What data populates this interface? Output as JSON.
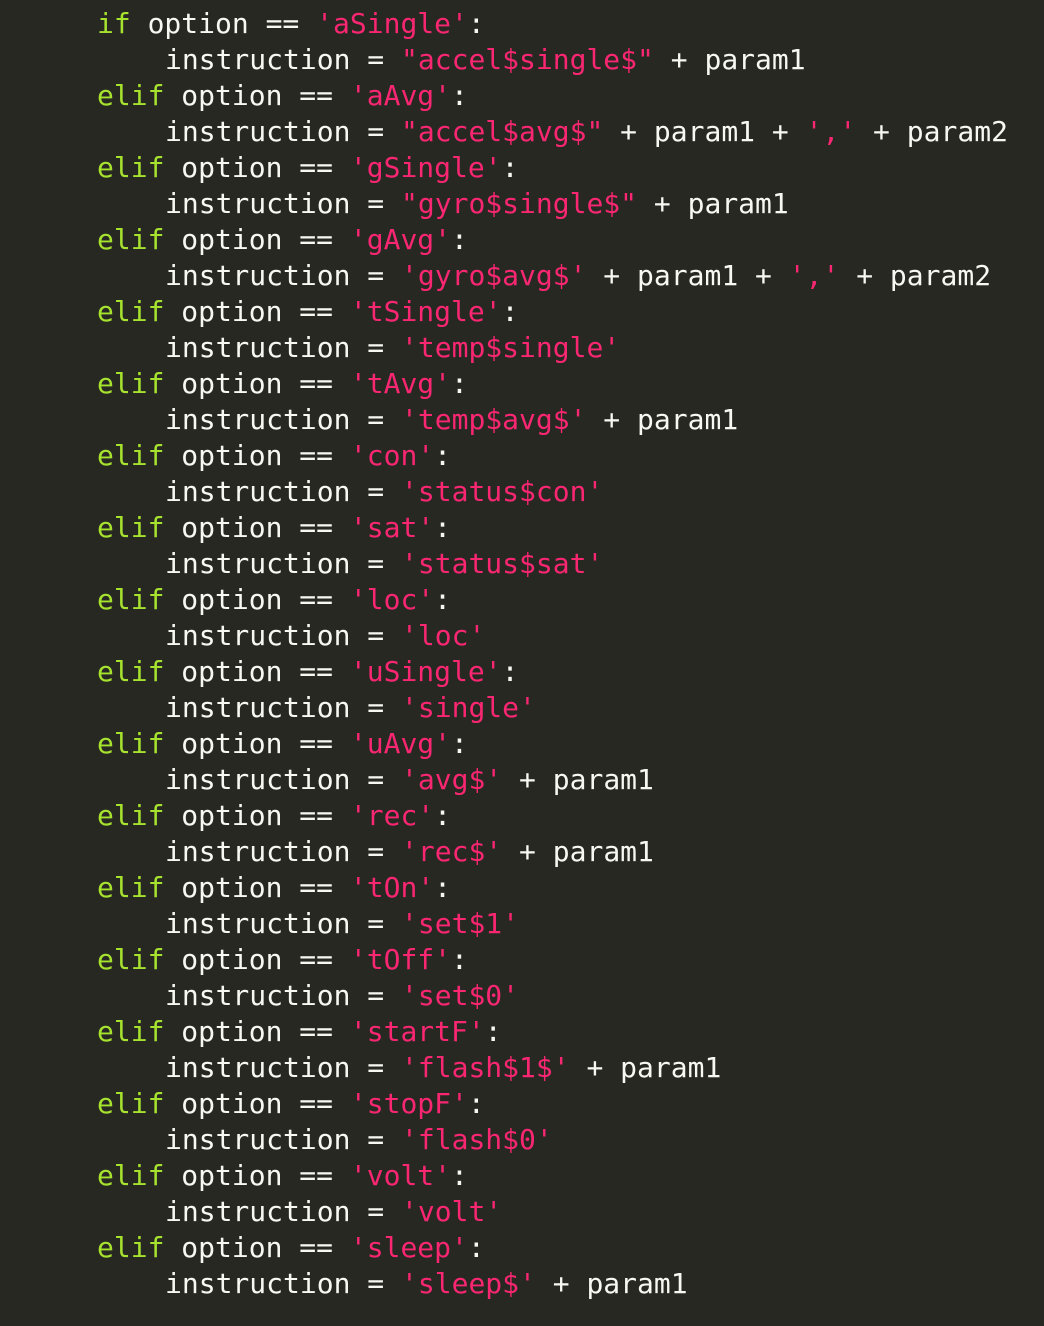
{
  "editor": {
    "theme_colors": {
      "background": "#272822",
      "keyword": "#a6e22e",
      "string": "#f92672",
      "text": "#f8f8f2"
    },
    "lines": [
      {
        "indent": 1,
        "tokens": [
          {
            "t": "kw",
            "v": "if"
          },
          {
            "t": "id",
            "v": " option "
          },
          {
            "t": "op",
            "v": "=="
          },
          {
            "t": "id",
            "v": " "
          },
          {
            "t": "str",
            "v": "'aSingle'"
          },
          {
            "t": "pun",
            "v": ":"
          }
        ]
      },
      {
        "indent": 2,
        "tokens": [
          {
            "t": "id",
            "v": "instruction "
          },
          {
            "t": "op",
            "v": "="
          },
          {
            "t": "id",
            "v": " "
          },
          {
            "t": "str",
            "v": "\"accel$single$\""
          },
          {
            "t": "op",
            "v": " + "
          },
          {
            "t": "id",
            "v": "param1"
          }
        ]
      },
      {
        "indent": 1,
        "tokens": [
          {
            "t": "kw",
            "v": "elif"
          },
          {
            "t": "id",
            "v": " option "
          },
          {
            "t": "op",
            "v": "=="
          },
          {
            "t": "id",
            "v": " "
          },
          {
            "t": "str",
            "v": "'aAvg'"
          },
          {
            "t": "pun",
            "v": ":"
          }
        ]
      },
      {
        "indent": 2,
        "tokens": [
          {
            "t": "id",
            "v": "instruction "
          },
          {
            "t": "op",
            "v": "="
          },
          {
            "t": "id",
            "v": " "
          },
          {
            "t": "str",
            "v": "\"accel$avg$\""
          },
          {
            "t": "op",
            "v": " + "
          },
          {
            "t": "id",
            "v": "param1"
          },
          {
            "t": "op",
            "v": " + "
          },
          {
            "t": "str",
            "v": "','"
          },
          {
            "t": "op",
            "v": " + "
          },
          {
            "t": "id",
            "v": "param2"
          }
        ]
      },
      {
        "indent": 1,
        "tokens": [
          {
            "t": "kw",
            "v": "elif"
          },
          {
            "t": "id",
            "v": " option "
          },
          {
            "t": "op",
            "v": "=="
          },
          {
            "t": "id",
            "v": " "
          },
          {
            "t": "str",
            "v": "'gSingle'"
          },
          {
            "t": "pun",
            "v": ":"
          }
        ]
      },
      {
        "indent": 2,
        "tokens": [
          {
            "t": "id",
            "v": "instruction "
          },
          {
            "t": "op",
            "v": "="
          },
          {
            "t": "id",
            "v": " "
          },
          {
            "t": "str",
            "v": "\"gyro$single$\""
          },
          {
            "t": "op",
            "v": " + "
          },
          {
            "t": "id",
            "v": "param1"
          }
        ]
      },
      {
        "indent": 1,
        "tokens": [
          {
            "t": "kw",
            "v": "elif"
          },
          {
            "t": "id",
            "v": " option "
          },
          {
            "t": "op",
            "v": "=="
          },
          {
            "t": "id",
            "v": " "
          },
          {
            "t": "str",
            "v": "'gAvg'"
          },
          {
            "t": "pun",
            "v": ":"
          }
        ]
      },
      {
        "indent": 2,
        "tokens": [
          {
            "t": "id",
            "v": "instruction "
          },
          {
            "t": "op",
            "v": "="
          },
          {
            "t": "id",
            "v": " "
          },
          {
            "t": "str",
            "v": "'gyro$avg$'"
          },
          {
            "t": "op",
            "v": " + "
          },
          {
            "t": "id",
            "v": "param1"
          },
          {
            "t": "op",
            "v": " + "
          },
          {
            "t": "str",
            "v": "','"
          },
          {
            "t": "op",
            "v": " + "
          },
          {
            "t": "id",
            "v": "param2"
          }
        ]
      },
      {
        "indent": 1,
        "tokens": [
          {
            "t": "kw",
            "v": "elif"
          },
          {
            "t": "id",
            "v": " option "
          },
          {
            "t": "op",
            "v": "=="
          },
          {
            "t": "id",
            "v": " "
          },
          {
            "t": "str",
            "v": "'tSingle'"
          },
          {
            "t": "pun",
            "v": ":"
          }
        ]
      },
      {
        "indent": 2,
        "tokens": [
          {
            "t": "id",
            "v": "instruction "
          },
          {
            "t": "op",
            "v": "="
          },
          {
            "t": "id",
            "v": " "
          },
          {
            "t": "str",
            "v": "'temp$single'"
          }
        ]
      },
      {
        "indent": 1,
        "tokens": [
          {
            "t": "kw",
            "v": "elif"
          },
          {
            "t": "id",
            "v": " option "
          },
          {
            "t": "op",
            "v": "=="
          },
          {
            "t": "id",
            "v": " "
          },
          {
            "t": "str",
            "v": "'tAvg'"
          },
          {
            "t": "pun",
            "v": ":"
          }
        ]
      },
      {
        "indent": 2,
        "tokens": [
          {
            "t": "id",
            "v": "instruction "
          },
          {
            "t": "op",
            "v": "="
          },
          {
            "t": "id",
            "v": " "
          },
          {
            "t": "str",
            "v": "'temp$avg$'"
          },
          {
            "t": "op",
            "v": " + "
          },
          {
            "t": "id",
            "v": "param1"
          }
        ]
      },
      {
        "indent": 1,
        "tokens": [
          {
            "t": "kw",
            "v": "elif"
          },
          {
            "t": "id",
            "v": " option "
          },
          {
            "t": "op",
            "v": "=="
          },
          {
            "t": "id",
            "v": " "
          },
          {
            "t": "str",
            "v": "'con'"
          },
          {
            "t": "pun",
            "v": ":"
          }
        ]
      },
      {
        "indent": 2,
        "tokens": [
          {
            "t": "id",
            "v": "instruction "
          },
          {
            "t": "op",
            "v": "="
          },
          {
            "t": "id",
            "v": " "
          },
          {
            "t": "str",
            "v": "'status$con'"
          }
        ]
      },
      {
        "indent": 1,
        "tokens": [
          {
            "t": "kw",
            "v": "elif"
          },
          {
            "t": "id",
            "v": " option "
          },
          {
            "t": "op",
            "v": "=="
          },
          {
            "t": "id",
            "v": " "
          },
          {
            "t": "str",
            "v": "'sat'"
          },
          {
            "t": "pun",
            "v": ":"
          }
        ]
      },
      {
        "indent": 2,
        "tokens": [
          {
            "t": "id",
            "v": "instruction "
          },
          {
            "t": "op",
            "v": "="
          },
          {
            "t": "id",
            "v": " "
          },
          {
            "t": "str",
            "v": "'status$sat'"
          }
        ]
      },
      {
        "indent": 1,
        "tokens": [
          {
            "t": "kw",
            "v": "elif"
          },
          {
            "t": "id",
            "v": " option "
          },
          {
            "t": "op",
            "v": "=="
          },
          {
            "t": "id",
            "v": " "
          },
          {
            "t": "str",
            "v": "'loc'"
          },
          {
            "t": "pun",
            "v": ":"
          }
        ]
      },
      {
        "indent": 2,
        "tokens": [
          {
            "t": "id",
            "v": "instruction "
          },
          {
            "t": "op",
            "v": "="
          },
          {
            "t": "id",
            "v": " "
          },
          {
            "t": "str",
            "v": "'loc'"
          }
        ]
      },
      {
        "indent": 1,
        "tokens": [
          {
            "t": "kw",
            "v": "elif"
          },
          {
            "t": "id",
            "v": " option "
          },
          {
            "t": "op",
            "v": "=="
          },
          {
            "t": "id",
            "v": " "
          },
          {
            "t": "str",
            "v": "'uSingle'"
          },
          {
            "t": "pun",
            "v": ":"
          }
        ]
      },
      {
        "indent": 2,
        "tokens": [
          {
            "t": "id",
            "v": "instruction "
          },
          {
            "t": "op",
            "v": "="
          },
          {
            "t": "id",
            "v": " "
          },
          {
            "t": "str",
            "v": "'single'"
          }
        ]
      },
      {
        "indent": 1,
        "tokens": [
          {
            "t": "kw",
            "v": "elif"
          },
          {
            "t": "id",
            "v": " option "
          },
          {
            "t": "op",
            "v": "=="
          },
          {
            "t": "id",
            "v": " "
          },
          {
            "t": "str",
            "v": "'uAvg'"
          },
          {
            "t": "pun",
            "v": ":"
          }
        ]
      },
      {
        "indent": 2,
        "tokens": [
          {
            "t": "id",
            "v": "instruction "
          },
          {
            "t": "op",
            "v": "="
          },
          {
            "t": "id",
            "v": " "
          },
          {
            "t": "str",
            "v": "'avg$'"
          },
          {
            "t": "op",
            "v": " + "
          },
          {
            "t": "id",
            "v": "param1"
          }
        ]
      },
      {
        "indent": 1,
        "tokens": [
          {
            "t": "kw",
            "v": "elif"
          },
          {
            "t": "id",
            "v": " option "
          },
          {
            "t": "op",
            "v": "=="
          },
          {
            "t": "id",
            "v": " "
          },
          {
            "t": "str",
            "v": "'rec'"
          },
          {
            "t": "pun",
            "v": ":"
          }
        ]
      },
      {
        "indent": 2,
        "tokens": [
          {
            "t": "id",
            "v": "instruction "
          },
          {
            "t": "op",
            "v": "="
          },
          {
            "t": "id",
            "v": " "
          },
          {
            "t": "str",
            "v": "'rec$'"
          },
          {
            "t": "op",
            "v": " + "
          },
          {
            "t": "id",
            "v": "param1"
          }
        ]
      },
      {
        "indent": 1,
        "tokens": [
          {
            "t": "kw",
            "v": "elif"
          },
          {
            "t": "id",
            "v": " option "
          },
          {
            "t": "op",
            "v": "=="
          },
          {
            "t": "id",
            "v": " "
          },
          {
            "t": "str",
            "v": "'tOn'"
          },
          {
            "t": "pun",
            "v": ":"
          }
        ]
      },
      {
        "indent": 2,
        "tokens": [
          {
            "t": "id",
            "v": "instruction "
          },
          {
            "t": "op",
            "v": "="
          },
          {
            "t": "id",
            "v": " "
          },
          {
            "t": "str",
            "v": "'set$1'"
          }
        ]
      },
      {
        "indent": 1,
        "tokens": [
          {
            "t": "kw",
            "v": "elif"
          },
          {
            "t": "id",
            "v": " option "
          },
          {
            "t": "op",
            "v": "=="
          },
          {
            "t": "id",
            "v": " "
          },
          {
            "t": "str",
            "v": "'tOff'"
          },
          {
            "t": "pun",
            "v": ":"
          }
        ]
      },
      {
        "indent": 2,
        "tokens": [
          {
            "t": "id",
            "v": "instruction "
          },
          {
            "t": "op",
            "v": "="
          },
          {
            "t": "id",
            "v": " "
          },
          {
            "t": "str",
            "v": "'set$0'"
          }
        ]
      },
      {
        "indent": 1,
        "tokens": [
          {
            "t": "kw",
            "v": "elif"
          },
          {
            "t": "id",
            "v": " option "
          },
          {
            "t": "op",
            "v": "=="
          },
          {
            "t": "id",
            "v": " "
          },
          {
            "t": "str",
            "v": "'startF'"
          },
          {
            "t": "pun",
            "v": ":"
          }
        ]
      },
      {
        "indent": 2,
        "tokens": [
          {
            "t": "id",
            "v": "instruction "
          },
          {
            "t": "op",
            "v": "="
          },
          {
            "t": "id",
            "v": " "
          },
          {
            "t": "str",
            "v": "'flash$1$'"
          },
          {
            "t": "op",
            "v": " + "
          },
          {
            "t": "id",
            "v": "param1"
          }
        ]
      },
      {
        "indent": 1,
        "tokens": [
          {
            "t": "kw",
            "v": "elif"
          },
          {
            "t": "id",
            "v": " option "
          },
          {
            "t": "op",
            "v": "=="
          },
          {
            "t": "id",
            "v": " "
          },
          {
            "t": "str",
            "v": "'stopF'"
          },
          {
            "t": "pun",
            "v": ":"
          }
        ]
      },
      {
        "indent": 2,
        "tokens": [
          {
            "t": "id",
            "v": "instruction "
          },
          {
            "t": "op",
            "v": "="
          },
          {
            "t": "id",
            "v": " "
          },
          {
            "t": "str",
            "v": "'flash$0'"
          }
        ]
      },
      {
        "indent": 1,
        "tokens": [
          {
            "t": "kw",
            "v": "elif"
          },
          {
            "t": "id",
            "v": " option "
          },
          {
            "t": "op",
            "v": "=="
          },
          {
            "t": "id",
            "v": " "
          },
          {
            "t": "str",
            "v": "'volt'"
          },
          {
            "t": "pun",
            "v": ":"
          }
        ]
      },
      {
        "indent": 2,
        "tokens": [
          {
            "t": "id",
            "v": "instruction "
          },
          {
            "t": "op",
            "v": "="
          },
          {
            "t": "id",
            "v": " "
          },
          {
            "t": "str",
            "v": "'volt'"
          }
        ]
      },
      {
        "indent": 1,
        "tokens": [
          {
            "t": "kw",
            "v": "elif"
          },
          {
            "t": "id",
            "v": " option "
          },
          {
            "t": "op",
            "v": "=="
          },
          {
            "t": "id",
            "v": " "
          },
          {
            "t": "str",
            "v": "'sleep'"
          },
          {
            "t": "pun",
            "v": ":"
          }
        ]
      },
      {
        "indent": 2,
        "tokens": [
          {
            "t": "id",
            "v": "instruction "
          },
          {
            "t": "op",
            "v": "="
          },
          {
            "t": "id",
            "v": " "
          },
          {
            "t": "str",
            "v": "'sleep$'"
          },
          {
            "t": "op",
            "v": " + "
          },
          {
            "t": "id",
            "v": "param1"
          }
        ]
      }
    ]
  }
}
